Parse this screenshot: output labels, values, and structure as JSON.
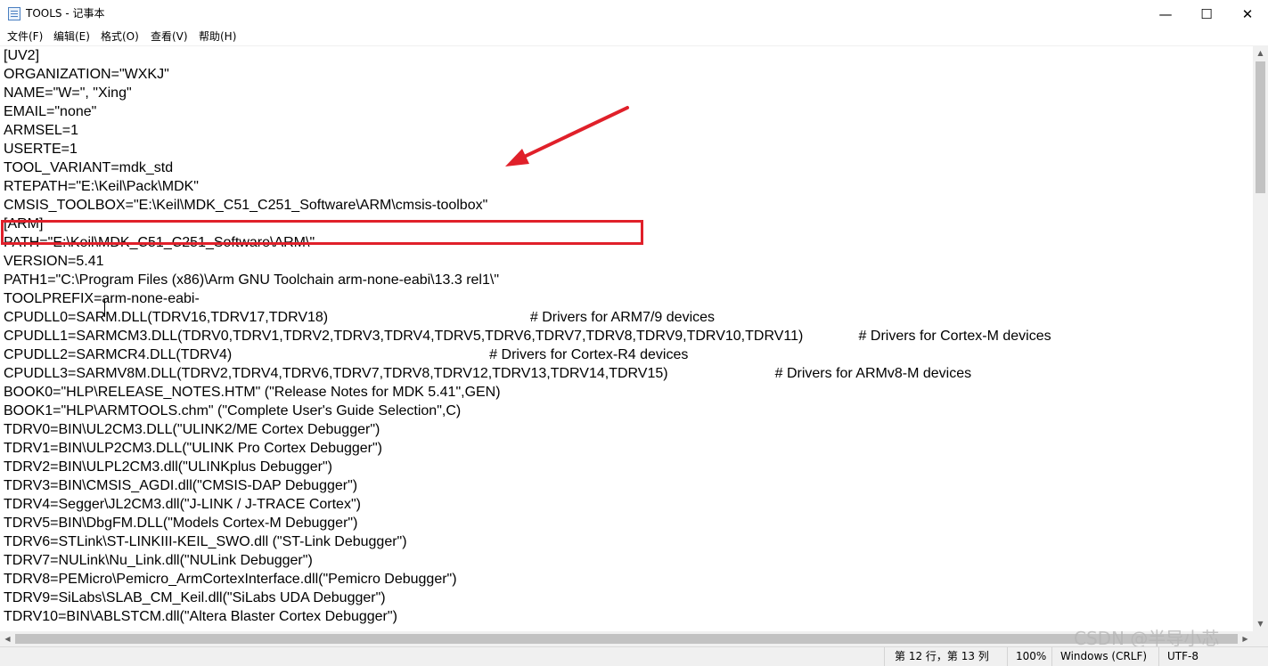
{
  "window": {
    "title": "TOOLS - 记事本",
    "app_icon": "notepad-icon",
    "controls": {
      "minimize": "—",
      "maximize": "☐",
      "close": "✕"
    }
  },
  "menu": [
    "文件(F)",
    "编辑(E)",
    "格式(O)",
    "查看(V)",
    "帮助(H)"
  ],
  "editor": {
    "lines": [
      "[UV2]",
      "ORGANIZATION=\"WXKJ\"",
      "NAME=\"W=\", \"Xing\"",
      "EMAIL=\"none\"",
      "ARMSEL=1",
      "USERTE=1",
      "TOOL_VARIANT=mdk_std",
      "RTEPATH=\"E:\\Keil\\Pack\\MDK\"",
      "CMSIS_TOOLBOX=\"E:\\Keil\\MDK_C51_C251_Software\\ARM\\cmsis-toolbox\"",
      "[ARM]",
      "PATH=\"E:\\Keil\\MDK_C51_C251_Software\\ARM\\\"",
      "VERSION=5.41",
      "PATH1=\"C:\\Program Files (x86)\\Arm GNU Toolchain arm-none-eabi\\13.3 rel1\\\"",
      "TOOLPREFIX=arm-none-eabi-",
      "CPUDLL0=SARM.DLL(TDRV16,TDRV17,TDRV18)                                                   # Drivers for ARM7/9 devices",
      "CPUDLL1=SARMCM3.DLL(TDRV0,TDRV1,TDRV2,TDRV3,TDRV4,TDRV5,TDRV6,TDRV7,TDRV8,TDRV9,TDRV10,TDRV11)              # Drivers for Cortex-M devices",
      "CPUDLL2=SARMCR4.DLL(TDRV4)                                                                 # Drivers for Cortex-R4 devices",
      "CPUDLL3=SARMV8M.DLL(TDRV2,TDRV4,TDRV6,TDRV7,TDRV8,TDRV12,TDRV13,TDRV14,TDRV15)                           # Drivers for ARMv8-M devices",
      "BOOK0=\"HLP\\RELEASE_NOTES.HTM\" (\"Release Notes for MDK 5.41\",GEN)",
      "BOOK1=\"HLP\\ARMTOOLS.chm\" (\"Complete User's Guide Selection\",C)",
      "TDRV0=BIN\\UL2CM3.DLL(\"ULINK2/ME Cortex Debugger\")",
      "TDRV1=BIN\\ULP2CM3.DLL(\"ULINK Pro Cortex Debugger\")",
      "TDRV2=BIN\\ULPL2CM3.dll(\"ULINKplus Debugger\")",
      "TDRV3=BIN\\CMSIS_AGDI.dll(\"CMSIS-DAP Debugger\")",
      "TDRV4=Segger\\JL2CM3.dll(\"J-LINK / J-TRACE Cortex\")",
      "TDRV5=BIN\\DbgFM.DLL(\"Models Cortex-M Debugger\")",
      "TDRV6=STLink\\ST-LINKIII-KEIL_SWO.dll (\"ST-Link Debugger\")",
      "TDRV7=NULink\\Nu_Link.dll(\"NULink Debugger\")",
      "TDRV8=PEMicro\\Pemicro_ArmCortexInterface.dll(\"Pemicro Debugger\")",
      "TDRV9=SiLabs\\SLAB_CM_Keil.dll(\"SiLabs UDA Debugger\")",
      "TDRV10=BIN\\ABLSTCM.dll(\"Altera Blaster Cortex Debugger\")"
    ],
    "highlighted_line_index": 7,
    "caret_line_index": 11
  },
  "status": {
    "position": "第 12 行，第 13 列",
    "zoom": "100%",
    "line_ending": "Windows (CRLF)",
    "encoding": "UTF-8"
  },
  "watermark": "CSDN @半导小芯",
  "colors": {
    "annotation": "#e0202a"
  }
}
